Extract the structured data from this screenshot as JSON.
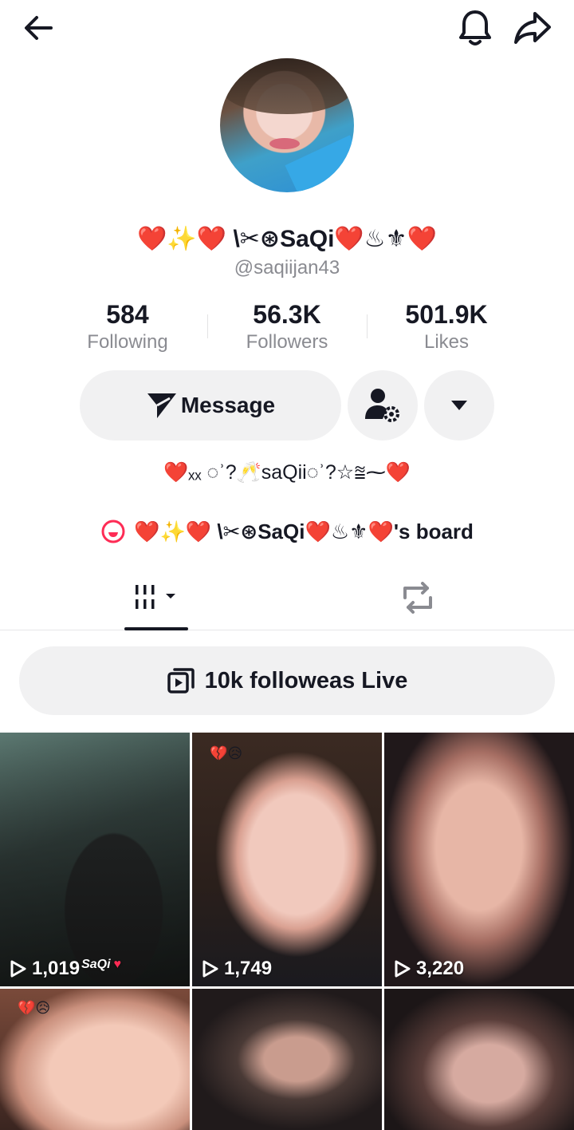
{
  "topbar": {
    "back_icon": "arrow-left-icon",
    "bell_icon": "bell-icon",
    "share_icon": "share-arrow-icon"
  },
  "profile": {
    "display_name": "❤️✨❤️ \\✂⊛SaQi❤️♨⚜❤️",
    "handle": "@saqiijan43",
    "stats": [
      {
        "value": "584",
        "label": "Following"
      },
      {
        "value": "56.3K",
        "label": "Followers"
      },
      {
        "value": "501.9K",
        "label": "Likes"
      }
    ]
  },
  "actions": {
    "message_label": "Message",
    "message_icon": "send-icon",
    "follow_settings_icon": "person-gear-icon",
    "more_icon": "caret-down-icon"
  },
  "bio": "❤️ₓₓ ◌ʾ?🥂sаQii◌ʾ?☆⩰⁓❤️",
  "board": {
    "icon": "board-icon",
    "label": "❤️✨❤️ \\✂⊛SaQi❤️♨⚜❤️'s board"
  },
  "tabs": [
    {
      "name": "videos",
      "icon": "grid-bars-icon",
      "active": true
    },
    {
      "name": "reposts",
      "icon": "repost-icon",
      "active": false
    }
  ],
  "playlist": {
    "icon": "playlist-icon",
    "label": "10k followeas Live"
  },
  "videos": [
    {
      "views": "1,019",
      "watermark": "SaQi"
    },
    {
      "views": "1,749"
    },
    {
      "views": "3,220"
    },
    {
      "views": ""
    },
    {
      "views": ""
    },
    {
      "views": ""
    }
  ],
  "colors": {
    "text": "#161823",
    "muted": "#8a8b91",
    "button_bg": "#f1f1f2",
    "accent_red": "#fe2c55"
  }
}
